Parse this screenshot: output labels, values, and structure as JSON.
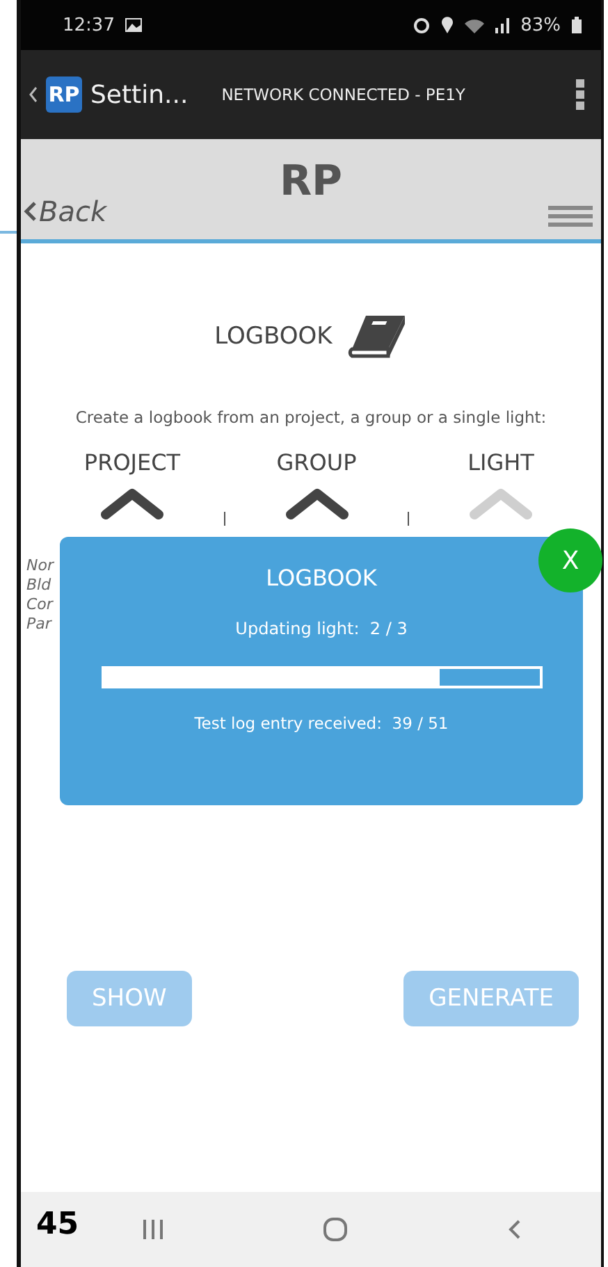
{
  "status_bar": {
    "time": "12:37",
    "battery": "83%"
  },
  "app_bar": {
    "logo": "RP",
    "title": "Settin...",
    "subtitle": "NETWORK CONNECTED - PE1Y"
  },
  "header": {
    "logo": "RP",
    "back": "Back"
  },
  "logbook": {
    "title": "LOGBOOK",
    "description": "Create a logbook from an project, a group or a single light:",
    "sources": [
      {
        "label": "PROJECT",
        "disabled": false
      },
      {
        "label": "GROUP",
        "disabled": false
      },
      {
        "label": "LIGHT",
        "disabled": true
      }
    ],
    "covered_lines": [
      "Nor",
      "Bld",
      "Cor",
      "Par"
    ]
  },
  "dialog": {
    "title": "LOGBOOK",
    "status": "Updating light:  2 / 3",
    "progress": {
      "level": 0.77
    },
    "detail": "Test log entry received:  39 / 51",
    "close": "X"
  },
  "buttons": [
    {
      "label": "SHOW"
    },
    {
      "label": "GENERATE"
    }
  ],
  "page_number": "45"
}
